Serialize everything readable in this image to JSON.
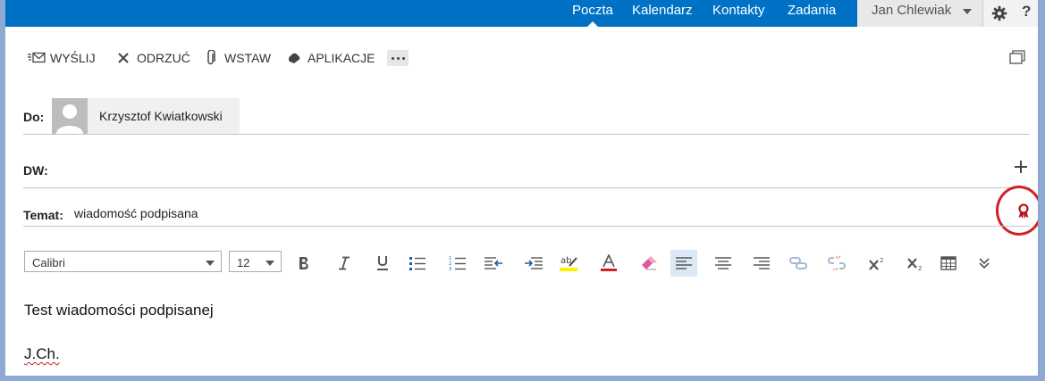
{
  "nav": {
    "mail": "Poczta",
    "calendar": "Kalendarz",
    "contacts": "Kontakty",
    "tasks": "Zadania"
  },
  "user": {
    "name": "Jan Chlewiak"
  },
  "help_label": "?",
  "toolbar": {
    "send": "WYŚLIJ",
    "discard": "ODRZUĆ",
    "insert": "WSTAW",
    "apps": "APLIKACJE"
  },
  "fields": {
    "to_label": "Do:",
    "to_recipient": "Krzysztof Kwiatkowski",
    "cc_label": "DW:",
    "subject_label": "Temat:",
    "subject_value": "wiadomość podpisana"
  },
  "format": {
    "font": "Calibri",
    "size": "12"
  },
  "body": {
    "line1": "Test wiadomości podpisanej",
    "line2": "J.Ch."
  },
  "colors": {
    "nav": "#0072c6",
    "accent_red": "#d21f26",
    "highlight_yellow": "#ffef00",
    "font_red": "#d21f26"
  }
}
